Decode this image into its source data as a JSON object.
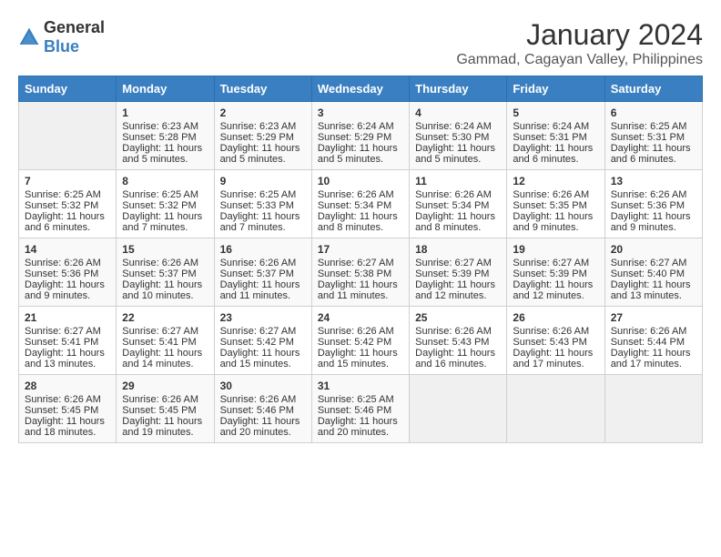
{
  "header": {
    "logo_general": "General",
    "logo_blue": "Blue",
    "title": "January 2024",
    "subtitle": "Gammad, Cagayan Valley, Philippines"
  },
  "days_of_week": [
    "Sunday",
    "Monday",
    "Tuesday",
    "Wednesday",
    "Thursday",
    "Friday",
    "Saturday"
  ],
  "weeks": [
    [
      {
        "day": "",
        "sunrise": "",
        "sunset": "",
        "daylight": "",
        "empty": true
      },
      {
        "day": "1",
        "sunrise": "Sunrise: 6:23 AM",
        "sunset": "Sunset: 5:28 PM",
        "daylight": "Daylight: 11 hours and 5 minutes."
      },
      {
        "day": "2",
        "sunrise": "Sunrise: 6:23 AM",
        "sunset": "Sunset: 5:29 PM",
        "daylight": "Daylight: 11 hours and 5 minutes."
      },
      {
        "day": "3",
        "sunrise": "Sunrise: 6:24 AM",
        "sunset": "Sunset: 5:29 PM",
        "daylight": "Daylight: 11 hours and 5 minutes."
      },
      {
        "day": "4",
        "sunrise": "Sunrise: 6:24 AM",
        "sunset": "Sunset: 5:30 PM",
        "daylight": "Daylight: 11 hours and 5 minutes."
      },
      {
        "day": "5",
        "sunrise": "Sunrise: 6:24 AM",
        "sunset": "Sunset: 5:31 PM",
        "daylight": "Daylight: 11 hours and 6 minutes."
      },
      {
        "day": "6",
        "sunrise": "Sunrise: 6:25 AM",
        "sunset": "Sunset: 5:31 PM",
        "daylight": "Daylight: 11 hours and 6 minutes."
      }
    ],
    [
      {
        "day": "7",
        "sunrise": "Sunrise: 6:25 AM",
        "sunset": "Sunset: 5:32 PM",
        "daylight": "Daylight: 11 hours and 6 minutes."
      },
      {
        "day": "8",
        "sunrise": "Sunrise: 6:25 AM",
        "sunset": "Sunset: 5:32 PM",
        "daylight": "Daylight: 11 hours and 7 minutes."
      },
      {
        "day": "9",
        "sunrise": "Sunrise: 6:25 AM",
        "sunset": "Sunset: 5:33 PM",
        "daylight": "Daylight: 11 hours and 7 minutes."
      },
      {
        "day": "10",
        "sunrise": "Sunrise: 6:26 AM",
        "sunset": "Sunset: 5:34 PM",
        "daylight": "Daylight: 11 hours and 8 minutes."
      },
      {
        "day": "11",
        "sunrise": "Sunrise: 6:26 AM",
        "sunset": "Sunset: 5:34 PM",
        "daylight": "Daylight: 11 hours and 8 minutes."
      },
      {
        "day": "12",
        "sunrise": "Sunrise: 6:26 AM",
        "sunset": "Sunset: 5:35 PM",
        "daylight": "Daylight: 11 hours and 9 minutes."
      },
      {
        "day": "13",
        "sunrise": "Sunrise: 6:26 AM",
        "sunset": "Sunset: 5:36 PM",
        "daylight": "Daylight: 11 hours and 9 minutes."
      }
    ],
    [
      {
        "day": "14",
        "sunrise": "Sunrise: 6:26 AM",
        "sunset": "Sunset: 5:36 PM",
        "daylight": "Daylight: 11 hours and 9 minutes."
      },
      {
        "day": "15",
        "sunrise": "Sunrise: 6:26 AM",
        "sunset": "Sunset: 5:37 PM",
        "daylight": "Daylight: 11 hours and 10 minutes."
      },
      {
        "day": "16",
        "sunrise": "Sunrise: 6:26 AM",
        "sunset": "Sunset: 5:37 PM",
        "daylight": "Daylight: 11 hours and 11 minutes."
      },
      {
        "day": "17",
        "sunrise": "Sunrise: 6:27 AM",
        "sunset": "Sunset: 5:38 PM",
        "daylight": "Daylight: 11 hours and 11 minutes."
      },
      {
        "day": "18",
        "sunrise": "Sunrise: 6:27 AM",
        "sunset": "Sunset: 5:39 PM",
        "daylight": "Daylight: 11 hours and 12 minutes."
      },
      {
        "day": "19",
        "sunrise": "Sunrise: 6:27 AM",
        "sunset": "Sunset: 5:39 PM",
        "daylight": "Daylight: 11 hours and 12 minutes."
      },
      {
        "day": "20",
        "sunrise": "Sunrise: 6:27 AM",
        "sunset": "Sunset: 5:40 PM",
        "daylight": "Daylight: 11 hours and 13 minutes."
      }
    ],
    [
      {
        "day": "21",
        "sunrise": "Sunrise: 6:27 AM",
        "sunset": "Sunset: 5:41 PM",
        "daylight": "Daylight: 11 hours and 13 minutes."
      },
      {
        "day": "22",
        "sunrise": "Sunrise: 6:27 AM",
        "sunset": "Sunset: 5:41 PM",
        "daylight": "Daylight: 11 hours and 14 minutes."
      },
      {
        "day": "23",
        "sunrise": "Sunrise: 6:27 AM",
        "sunset": "Sunset: 5:42 PM",
        "daylight": "Daylight: 11 hours and 15 minutes."
      },
      {
        "day": "24",
        "sunrise": "Sunrise: 6:26 AM",
        "sunset": "Sunset: 5:42 PM",
        "daylight": "Daylight: 11 hours and 15 minutes."
      },
      {
        "day": "25",
        "sunrise": "Sunrise: 6:26 AM",
        "sunset": "Sunset: 5:43 PM",
        "daylight": "Daylight: 11 hours and 16 minutes."
      },
      {
        "day": "26",
        "sunrise": "Sunrise: 6:26 AM",
        "sunset": "Sunset: 5:43 PM",
        "daylight": "Daylight: 11 hours and 17 minutes."
      },
      {
        "day": "27",
        "sunrise": "Sunrise: 6:26 AM",
        "sunset": "Sunset: 5:44 PM",
        "daylight": "Daylight: 11 hours and 17 minutes."
      }
    ],
    [
      {
        "day": "28",
        "sunrise": "Sunrise: 6:26 AM",
        "sunset": "Sunset: 5:45 PM",
        "daylight": "Daylight: 11 hours and 18 minutes."
      },
      {
        "day": "29",
        "sunrise": "Sunrise: 6:26 AM",
        "sunset": "Sunset: 5:45 PM",
        "daylight": "Daylight: 11 hours and 19 minutes."
      },
      {
        "day": "30",
        "sunrise": "Sunrise: 6:26 AM",
        "sunset": "Sunset: 5:46 PM",
        "daylight": "Daylight: 11 hours and 20 minutes."
      },
      {
        "day": "31",
        "sunrise": "Sunrise: 6:25 AM",
        "sunset": "Sunset: 5:46 PM",
        "daylight": "Daylight: 11 hours and 20 minutes."
      },
      {
        "day": "",
        "sunrise": "",
        "sunset": "",
        "daylight": "",
        "empty": true
      },
      {
        "day": "",
        "sunrise": "",
        "sunset": "",
        "daylight": "",
        "empty": true
      },
      {
        "day": "",
        "sunrise": "",
        "sunset": "",
        "daylight": "",
        "empty": true
      }
    ]
  ]
}
